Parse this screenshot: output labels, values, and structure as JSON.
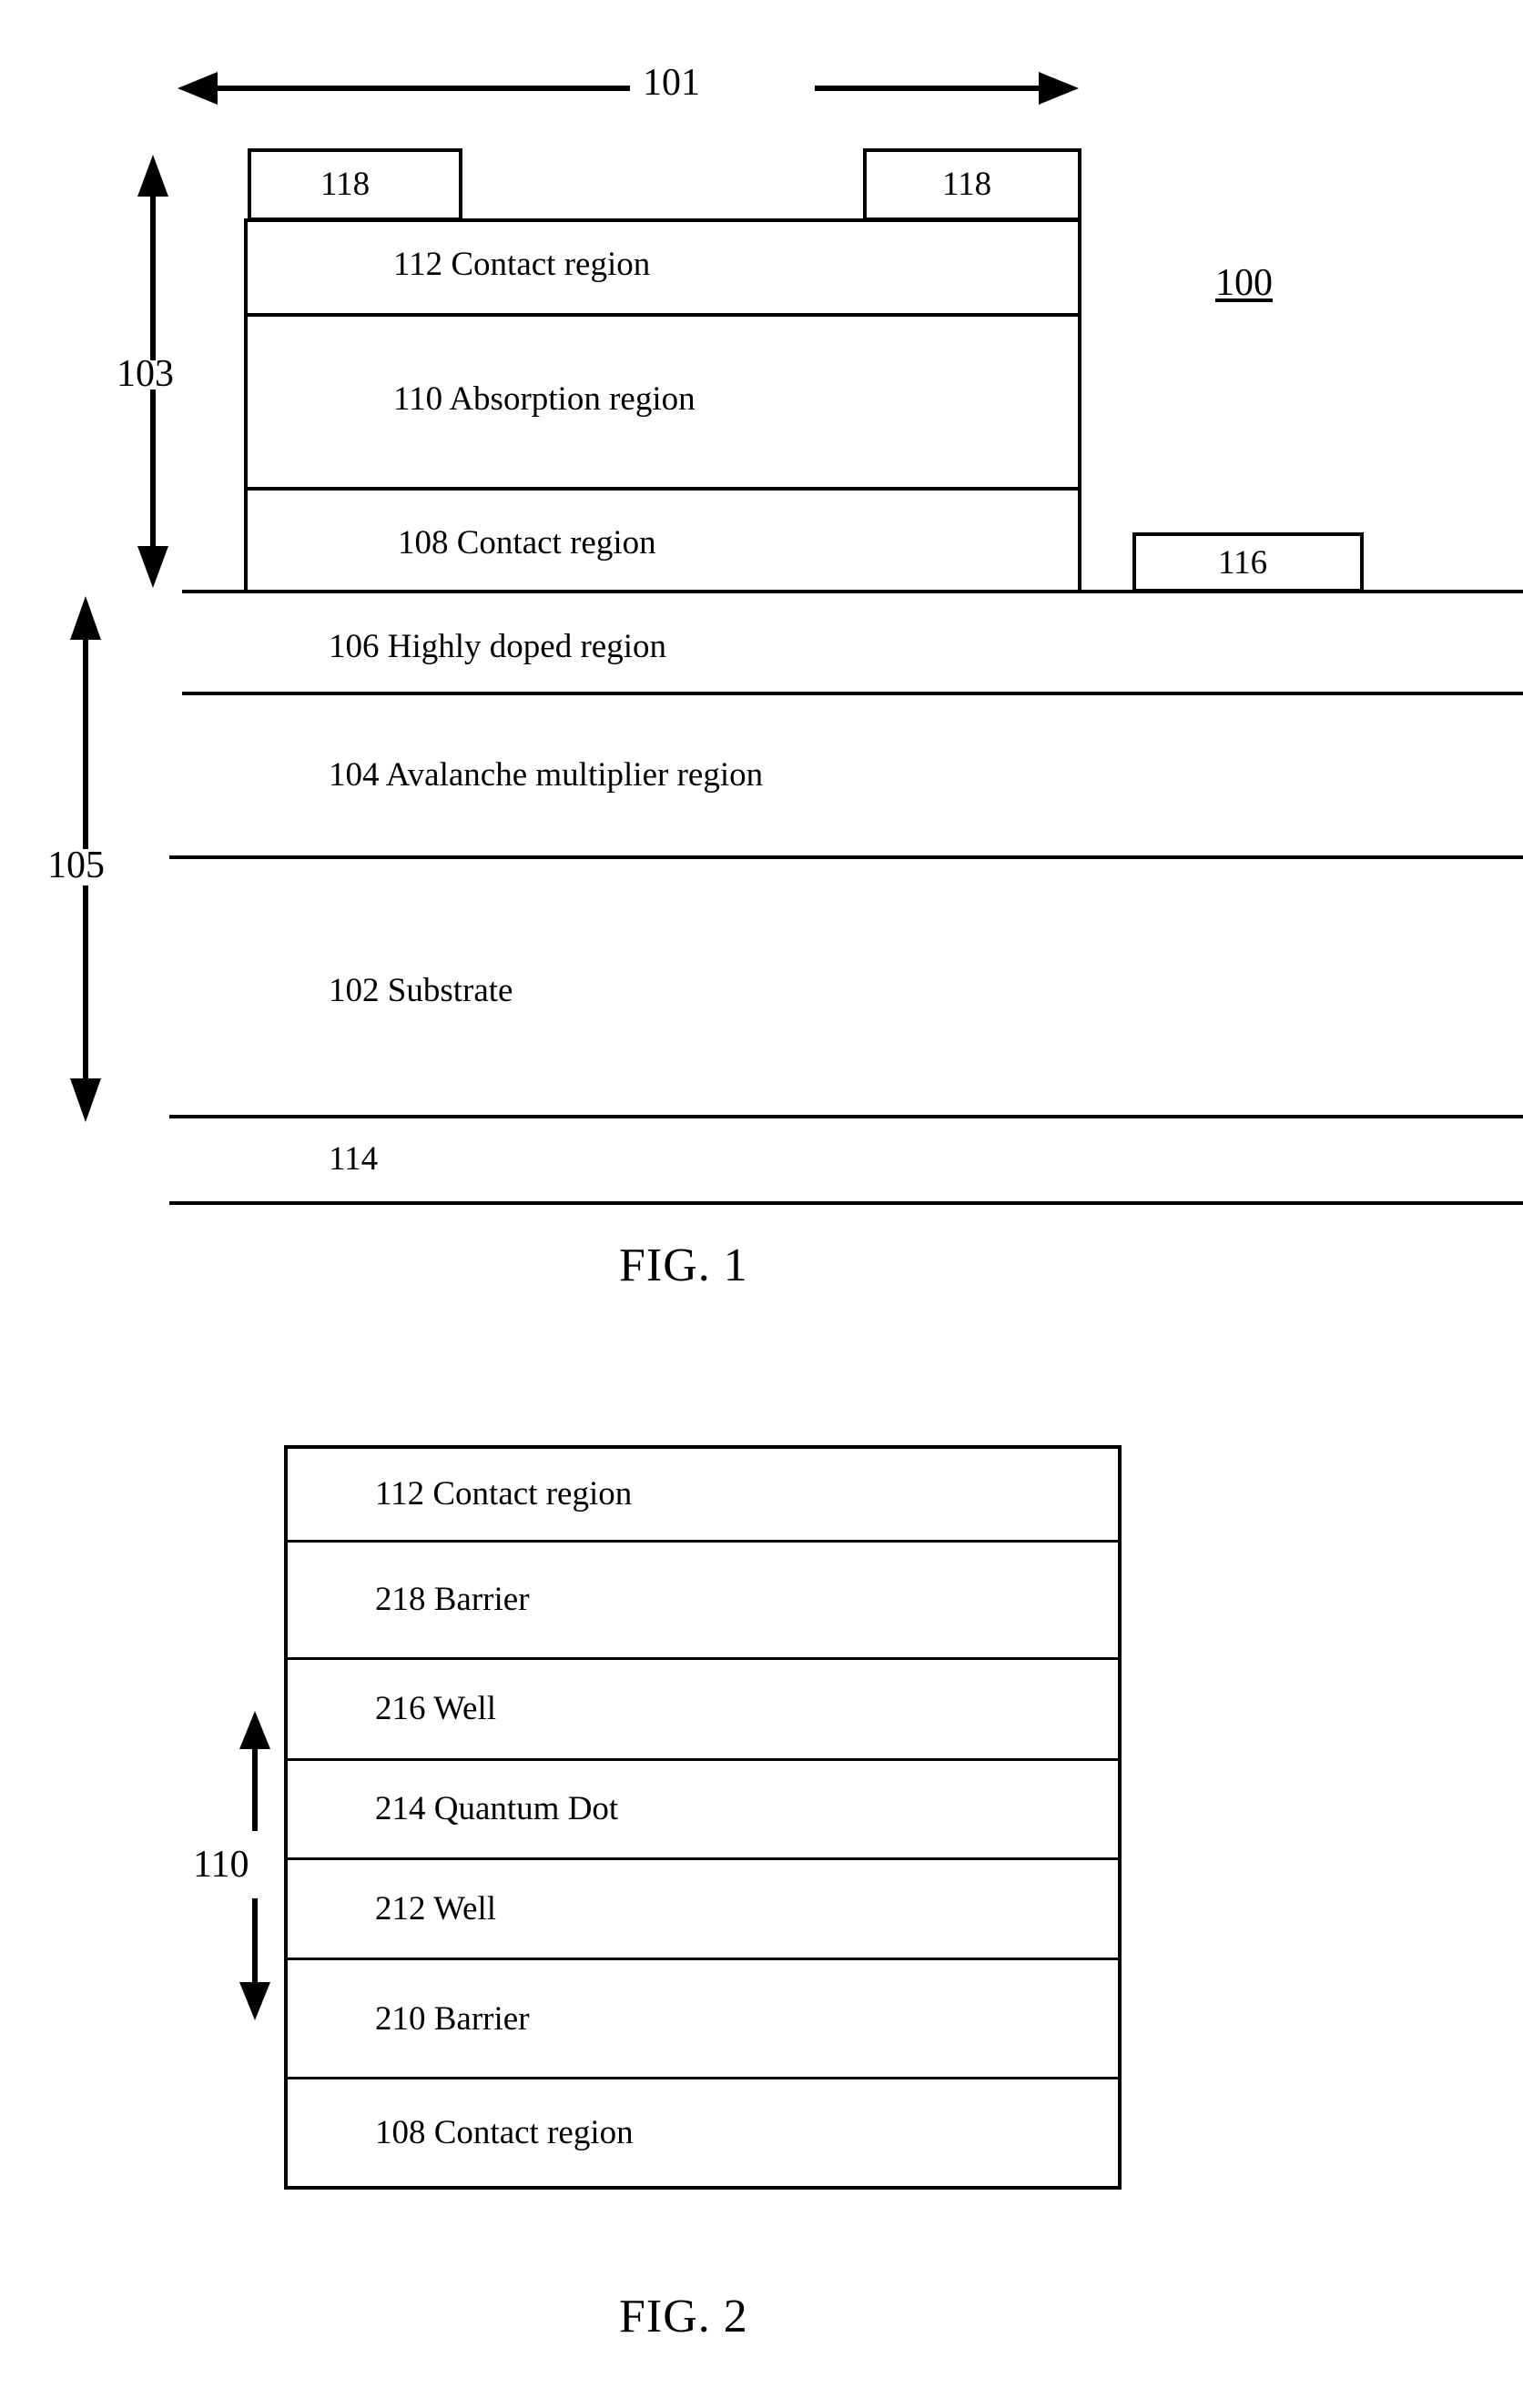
{
  "figure1": {
    "caption": "FIG. 1",
    "device_ref": "100",
    "width_dim_ref": "101",
    "mesa_height_dim_ref": "103",
    "substrate_stack_dim_ref": "105",
    "contacts": [
      {
        "ref": "118"
      },
      {
        "ref": "118"
      }
    ],
    "side_contact_ref": "116",
    "bottom_contact_ref": "114",
    "layers": [
      {
        "ref": "112",
        "name": "Contact region",
        "label": "112 Contact region"
      },
      {
        "ref": "110",
        "name": "Absorption region",
        "label": "110 Absorption region"
      },
      {
        "ref": "108",
        "name": "Contact region",
        "label": "108 Contact region"
      },
      {
        "ref": "106",
        "name": "Highly doped region",
        "label": "106 Highly doped region"
      },
      {
        "ref": "104",
        "name": "Avalanche multiplier region",
        "label": "104 Avalanche multiplier region"
      },
      {
        "ref": "102",
        "name": "Substrate",
        "label": "102 Substrate"
      }
    ]
  },
  "figure2": {
    "caption": "FIG. 2",
    "absorption_dim_ref": "110",
    "layers": [
      {
        "ref": "112",
        "name": "Contact region",
        "label": "112 Contact region"
      },
      {
        "ref": "218",
        "name": "Barrier",
        "label": "218 Barrier"
      },
      {
        "ref": "216",
        "name": "Well",
        "label": "216 Well"
      },
      {
        "ref": "214",
        "name": "Quantum Dot",
        "label": "214 Quantum Dot"
      },
      {
        "ref": "212",
        "name": "Well",
        "label": "212 Well"
      },
      {
        "ref": "210",
        "name": "Barrier",
        "label": "210 Barrier"
      },
      {
        "ref": "108",
        "name": "Contact region",
        "label": "108 Contact region"
      }
    ]
  },
  "colors": {
    "ink": "#000000",
    "paper": "#ffffff"
  }
}
